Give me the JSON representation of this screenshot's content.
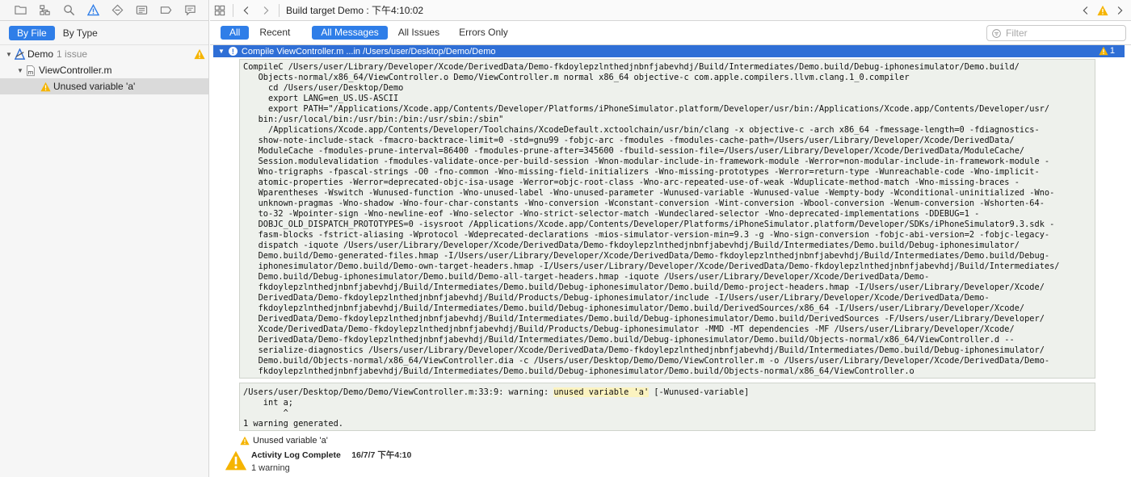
{
  "navigator": {
    "filter_by_file": "By File",
    "filter_by_type": "By Type",
    "tree": {
      "project": {
        "name": "Demo",
        "issues": "1 issue"
      },
      "file": {
        "name": "ViewController.m"
      },
      "issue": {
        "text": "Unused variable 'a'"
      }
    }
  },
  "jumpbar": {
    "title": "Build target Demo : 下午4:10:02"
  },
  "log_filter": {
    "all": "All",
    "recent": "Recent",
    "all_messages": "All Messages",
    "all_issues": "All Issues",
    "errors_only": "Errors Only",
    "search_placeholder": "Filter"
  },
  "log": {
    "step_title": "Compile ViewController.m ...in /Users/user/Desktop/Demo/Demo",
    "step_warning_count": "1",
    "command": "CompileC /Users/user/Library/Developer/Xcode/DerivedData/Demo-fkdoylepzlnthedjnbnfjabevhdj/Build/Intermediates/Demo.build/Debug-iphonesimulator/Demo.build/\n   Objects-normal/x86_64/ViewController.o Demo/ViewController.m normal x86_64 objective-c com.apple.compilers.llvm.clang.1_0.compiler\n     cd /Users/user/Desktop/Demo\n     export LANG=en_US.US-ASCII\n     export PATH=\"/Applications/Xcode.app/Contents/Developer/Platforms/iPhoneSimulator.platform/Developer/usr/bin:/Applications/Xcode.app/Contents/Developer/usr/\n   bin:/usr/local/bin:/usr/bin:/bin:/usr/sbin:/sbin\"\n     /Applications/Xcode.app/Contents/Developer/Toolchains/XcodeDefault.xctoolchain/usr/bin/clang -x objective-c -arch x86_64 -fmessage-length=0 -fdiagnostics-\n   show-note-include-stack -fmacro-backtrace-limit=0 -std=gnu99 -fobjc-arc -fmodules -fmodules-cache-path=/Users/user/Library/Developer/Xcode/DerivedData/\n   ModuleCache -fmodules-prune-interval=86400 -fmodules-prune-after=345600 -fbuild-session-file=/Users/user/Library/Developer/Xcode/DerivedData/ModuleCache/\n   Session.modulevalidation -fmodules-validate-once-per-build-session -Wnon-modular-include-in-framework-module -Werror=non-modular-include-in-framework-module -\n   Wno-trigraphs -fpascal-strings -O0 -fno-common -Wno-missing-field-initializers -Wno-missing-prototypes -Werror=return-type -Wunreachable-code -Wno-implicit-\n   atomic-properties -Werror=deprecated-objc-isa-usage -Werror=objc-root-class -Wno-arc-repeated-use-of-weak -Wduplicate-method-match -Wno-missing-braces -\n   Wparentheses -Wswitch -Wunused-function -Wno-unused-label -Wno-unused-parameter -Wunused-variable -Wunused-value -Wempty-body -Wconditional-uninitialized -Wno-\n   unknown-pragmas -Wno-shadow -Wno-four-char-constants -Wno-conversion -Wconstant-conversion -Wint-conversion -Wbool-conversion -Wenum-conversion -Wshorten-64-\n   to-32 -Wpointer-sign -Wno-newline-eof -Wno-selector -Wno-strict-selector-match -Wundeclared-selector -Wno-deprecated-implementations -DDEBUG=1 -\n   DOBJC_OLD_DISPATCH_PROTOTYPES=0 -isysroot /Applications/Xcode.app/Contents/Developer/Platforms/iPhoneSimulator.platform/Developer/SDKs/iPhoneSimulator9.3.sdk -\n   fasm-blocks -fstrict-aliasing -Wprotocol -Wdeprecated-declarations -mios-simulator-version-min=9.3 -g -Wno-sign-conversion -fobjc-abi-version=2 -fobjc-legacy-\n   dispatch -iquote /Users/user/Library/Developer/Xcode/DerivedData/Demo-fkdoylepzlnthedjnbnfjabevhdj/Build/Intermediates/Demo.build/Debug-iphonesimulator/\n   Demo.build/Demo-generated-files.hmap -I/Users/user/Library/Developer/Xcode/DerivedData/Demo-fkdoylepzlnthedjnbnfjabevhdj/Build/Intermediates/Demo.build/Debug-\n   iphonesimulator/Demo.build/Demo-own-target-headers.hmap -I/Users/user/Library/Developer/Xcode/DerivedData/Demo-fkdoylepzlnthedjnbnfjabevhdj/Build/Intermediates/\n   Demo.build/Debug-iphonesimulator/Demo.build/Demo-all-target-headers.hmap -iquote /Users/user/Library/Developer/Xcode/DerivedData/Demo-\n   fkdoylepzlnthedjnbnfjabevhdj/Build/Intermediates/Demo.build/Debug-iphonesimulator/Demo.build/Demo-project-headers.hmap -I/Users/user/Library/Developer/Xcode/\n   DerivedData/Demo-fkdoylepzlnthedjnbnfjabevhdj/Build/Products/Debug-iphonesimulator/include -I/Users/user/Library/Developer/Xcode/DerivedData/Demo-\n   fkdoylepzlnthedjnbnfjabevhdj/Build/Intermediates/Demo.build/Debug-iphonesimulator/Demo.build/DerivedSources/x86_64 -I/Users/user/Library/Developer/Xcode/\n   DerivedData/Demo-fkdoylepzlnthedjnbnfjabevhdj/Build/Intermediates/Demo.build/Debug-iphonesimulator/Demo.build/DerivedSources -F/Users/user/Library/Developer/\n   Xcode/DerivedData/Demo-fkdoylepzlnthedjnbnfjabevhdj/Build/Products/Debug-iphonesimulator -MMD -MT dependencies -MF /Users/user/Library/Developer/Xcode/\n   DerivedData/Demo-fkdoylepzlnthedjnbnfjabevhdj/Build/Intermediates/Demo.build/Debug-iphonesimulator/Demo.build/Objects-normal/x86_64/ViewController.d --\n   serialize-diagnostics /Users/user/Library/Developer/Xcode/DerivedData/Demo-fkdoylepzlnthedjnbnfjabevhdj/Build/Intermediates/Demo.build/Debug-iphonesimulator/\n   Demo.build/Objects-normal/x86_64/ViewController.dia -c /Users/user/Desktop/Demo/Demo/ViewController.m -o /Users/user/Library/Developer/Xcode/DerivedData/Demo-\n   fkdoylepzlnthedjnbnfjabevhdj/Build/Intermediates/Demo.build/Debug-iphonesimulator/Demo.build/Objects-normal/x86_64/ViewController.o",
    "output_prefix": "/Users/user/Desktop/Demo/Demo/ViewController.m:33:9: warning: ",
    "output_highlight": "unused variable 'a'",
    "output_suffix": " [-Wunused-variable]",
    "output_code_line": "    int a;",
    "output_caret_line": "        ^",
    "output_summary": "1 warning generated.",
    "issue_text": "Unused variable 'a'",
    "activity_title": "Activity Log Complete",
    "activity_date": "16/7/7 下午4:10",
    "activity_sub": "1 warning"
  },
  "colors": {
    "accent": "#2f7ee8",
    "warning": "#f5b400",
    "step_header": "#2f6fd6"
  }
}
